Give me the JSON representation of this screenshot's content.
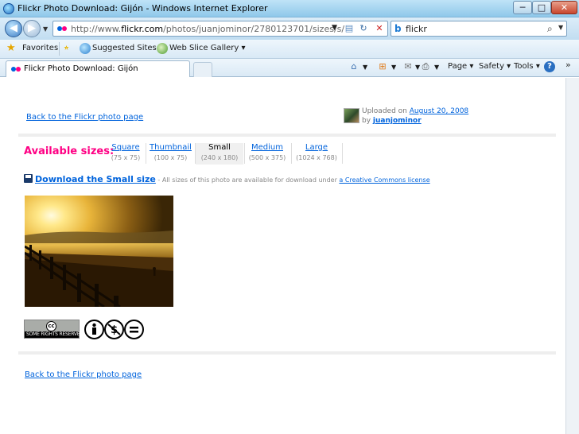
{
  "window": {
    "title": "Flickr Photo Download: Gijón - Windows Internet Explorer",
    "min_glyph": "─",
    "max_glyph": "□",
    "close_glyph": "✕"
  },
  "nav": {
    "address_prefix": "http://www.",
    "address_domain": "flickr.com",
    "address_path": "/photos/juanjominor/2780123701/sizes/s/",
    "search_value": "flickr",
    "search_engine_glyph": "b"
  },
  "favorites_bar": {
    "favorites_label": "Favorites",
    "suggested_sites_label": "Suggested Sites ▾",
    "web_slice_label": "Web Slice Gallery ▾"
  },
  "tabs": [
    {
      "label": "Flickr Photo Download: Gijón"
    }
  ],
  "command_bar": {
    "page_label": "Page ▾",
    "safety_label": "Safety ▾",
    "tools_label": "Tools ▾",
    "help_glyph": "?"
  },
  "page": {
    "back_link_top": "Back to the Flickr photo page",
    "uploaded_on_prefix": "Uploaded on ",
    "uploaded_date": "August 20, 2008",
    "by_prefix": "by ",
    "uploader_name": "juanjominor",
    "available_sizes_label": "Available sizes:",
    "sizes": [
      {
        "name": "Square",
        "dims": "(75 x 75)",
        "selected": false
      },
      {
        "name": "Thumbnail",
        "dims": "(100 x 75)",
        "selected": false
      },
      {
        "name": "Small",
        "dims": "(240 x 180)",
        "selected": true
      },
      {
        "name": "Medium",
        "dims": "(500 x 375)",
        "selected": false
      },
      {
        "name": "Large",
        "dims": "(1024 x 768)",
        "selected": false
      }
    ],
    "download_link": "Download the Small size",
    "download_note": " - All sizes of this photo are available for download under ",
    "cc_link": "a Creative Commons license",
    "cc_badge_text": "SOME RIGHTS RESERVED",
    "cc_glyph": "cc",
    "back_link_bottom": "Back to the Flickr photo page"
  },
  "colors": {
    "flickr_blue": "#0063dc",
    "flickr_pink": "#ff0084"
  }
}
